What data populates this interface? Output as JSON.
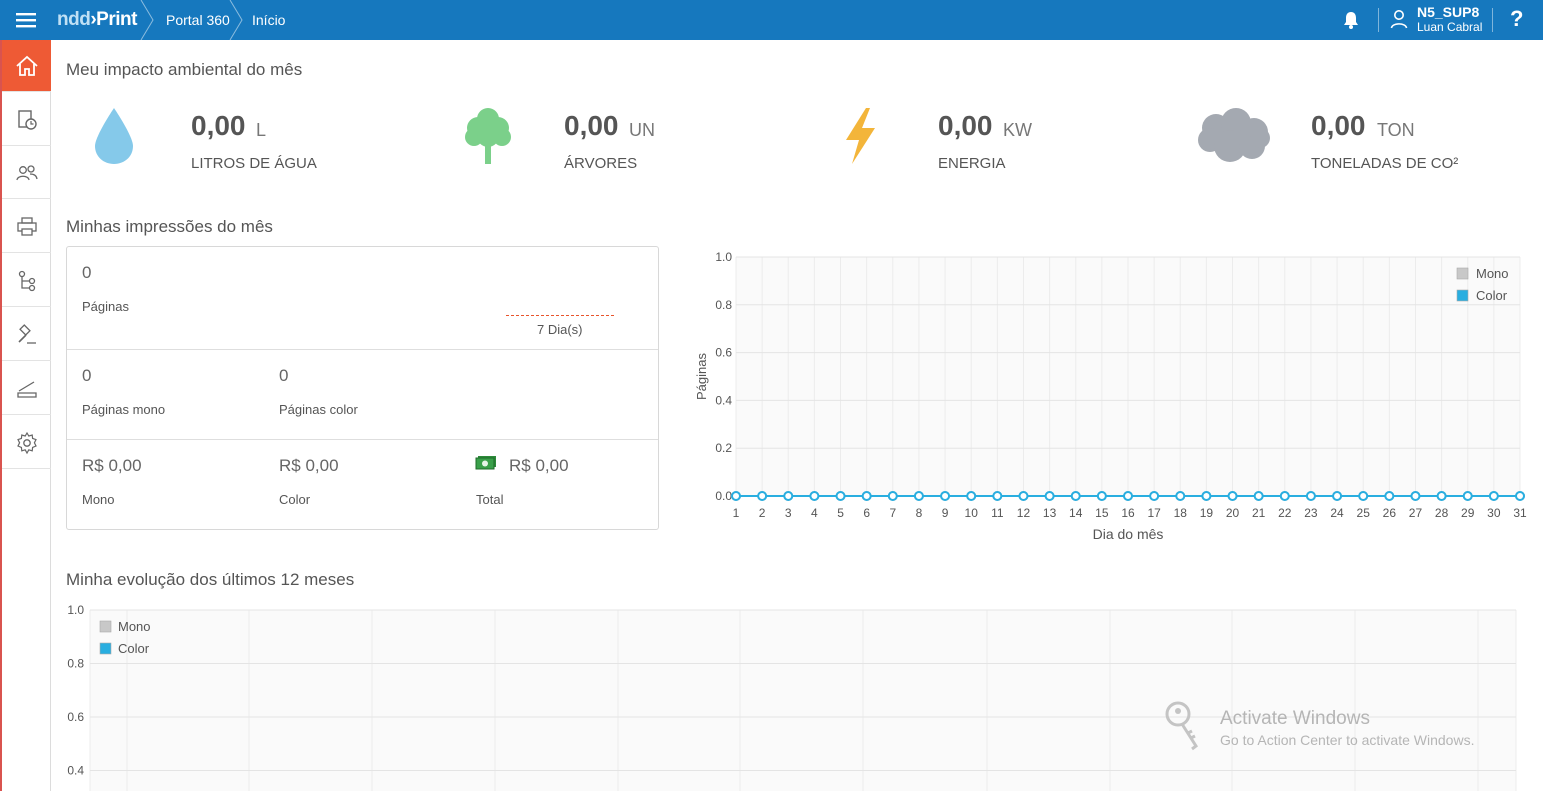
{
  "topbar": {
    "logo_prefix": "ndd",
    "logo_suffix": "Print",
    "breadcrumbs": [
      "Portal 360",
      "Início"
    ],
    "user_name": "N5_SUP8",
    "user_sub": "Luan Cabral",
    "help_label": "?",
    "icons": [
      "menu-icon",
      "bell-icon",
      "user-icon",
      "help-icon"
    ]
  },
  "sidebar": {
    "items": [
      "home-icon",
      "report-icon",
      "users-icon",
      "printer-icon",
      "workflow-icon",
      "auction-icon",
      "scanner-icon",
      "settings-icon"
    ],
    "active_color": "#ee5a35"
  },
  "impact": {
    "title": "Meu impacto ambiental do mês",
    "items": [
      {
        "value": "0,00",
        "unit": "L",
        "label": "LITROS DE ÁGUA",
        "icon": "water-drop-icon",
        "color": "#85c9ea"
      },
      {
        "value": "0,00",
        "unit": "UN",
        "label": "ÁRVORES",
        "icon": "tree-icon",
        "color": "#7bd08a"
      },
      {
        "value": "0,00",
        "unit": "KW",
        "label": "ENERGIA",
        "icon": "lightning-icon",
        "color": "#f3b53a"
      },
      {
        "value": "0,00",
        "unit": "TON",
        "label": "TONELADAS DE CO²",
        "icon": "cloud-icon",
        "color": "#a4a9b1"
      }
    ]
  },
  "prints": {
    "title": "Minhas impressões do mês",
    "pages_value": "0",
    "pages_label": "Páginas",
    "period_label": "7 Dia(s)",
    "mono_value": "0",
    "mono_label": "Páginas mono",
    "color_value": "0",
    "color_label": "Páginas color",
    "cost_mono_value": "R$ 0,00",
    "cost_mono_label": "Mono",
    "cost_color_value": "R$ 0,00",
    "cost_color_label": "Color",
    "cost_total_value": "R$ 0,00",
    "cost_total_label": "Total",
    "money_icon": "money-icon"
  },
  "evolution": {
    "title": "Minha evolução dos últimos 12 meses"
  },
  "watermark": {
    "title": "Activate Windows",
    "subtitle": "Go to Action Center to activate Windows."
  },
  "chart_data": [
    {
      "type": "line",
      "x": [
        1,
        2,
        3,
        4,
        5,
        6,
        7,
        8,
        9,
        10,
        11,
        12,
        13,
        14,
        15,
        16,
        17,
        18,
        19,
        20,
        21,
        22,
        23,
        24,
        25,
        26,
        27,
        28,
        29,
        30,
        31
      ],
      "series": [
        {
          "name": "Mono",
          "values": [
            0,
            0,
            0,
            0,
            0,
            0,
            0,
            0,
            0,
            0,
            0,
            0,
            0,
            0,
            0,
            0,
            0,
            0,
            0,
            0,
            0,
            0,
            0,
            0,
            0,
            0,
            0,
            0,
            0,
            0,
            0
          ],
          "color": "#c8c8c8"
        },
        {
          "name": "Color",
          "values": [
            0,
            0,
            0,
            0,
            0,
            0,
            0,
            0,
            0,
            0,
            0,
            0,
            0,
            0,
            0,
            0,
            0,
            0,
            0,
            0,
            0,
            0,
            0,
            0,
            0,
            0,
            0,
            0,
            0,
            0,
            0
          ],
          "color": "#29aee0"
        }
      ],
      "xlabel": "Dia do mês",
      "ylabel": "Páginas",
      "ylim": [
        0,
        1
      ],
      "yticks": [
        "0.0",
        "0.2",
        "0.4",
        "0.6",
        "0.8",
        "1.0"
      ],
      "grid": true,
      "legend": "top-right"
    },
    {
      "type": "line",
      "series": [
        {
          "name": "Mono",
          "values": [],
          "color": "#c8c8c8"
        },
        {
          "name": "Color",
          "values": [],
          "color": "#29aee0"
        }
      ],
      "ylim": [
        0,
        1
      ],
      "yticks": [
        "0.4",
        "0.6",
        "0.8",
        "1.0"
      ],
      "grid": true,
      "legend": "top-left"
    }
  ]
}
